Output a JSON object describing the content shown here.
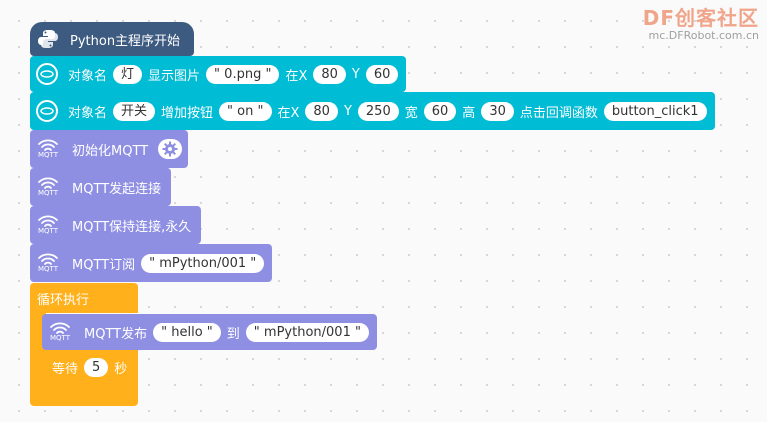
{
  "watermark": {
    "brand": "DF创客社区",
    "url": "mc.DFRobot.com.cn"
  },
  "blocks": {
    "start": {
      "label": "Python主程序开始"
    },
    "show_image": {
      "label_obj": "对象名",
      "obj": "灯",
      "label_action": "显示图片",
      "file": "0.png",
      "label_x": "在X",
      "x": "80",
      "label_y": "Y",
      "y": "60"
    },
    "add_button": {
      "label_obj": "对象名",
      "obj": "开关",
      "label_action": "增加按钮",
      "text": "on",
      "label_x": "在X",
      "x": "80",
      "label_y": "Y",
      "y": "250",
      "label_w": "宽",
      "w": "60",
      "label_h": "高",
      "h": "30",
      "label_cb": "点击回调函数",
      "callback": "button_click1"
    },
    "mqtt_init": {
      "label": "初始化MQTT"
    },
    "mqtt_connect": {
      "label": "MQTT发起连接"
    },
    "mqtt_keep": {
      "label": "MQTT保持连接,永久"
    },
    "mqtt_sub": {
      "label": "MQTT订阅",
      "topic": "mPython/001"
    },
    "loop": {
      "label": "循环执行"
    },
    "mqtt_pub": {
      "label": "MQTT发布",
      "message": "hello",
      "label_to": "到",
      "topic": "mPython/001"
    },
    "wait": {
      "label": "等待",
      "value": "5",
      "unit": "秒"
    }
  },
  "icons": {
    "hat": "python-icon",
    "screen": "screen-object-icon",
    "mqtt": "wifi-mqtt-icon",
    "mqtt_label": "MQTT",
    "settings": "gear-icon"
  },
  "colors": {
    "hat": "#3d5a80",
    "display": "#00bcd4",
    "mqtt": "#8e8fe3",
    "control": "#ffb01a"
  }
}
